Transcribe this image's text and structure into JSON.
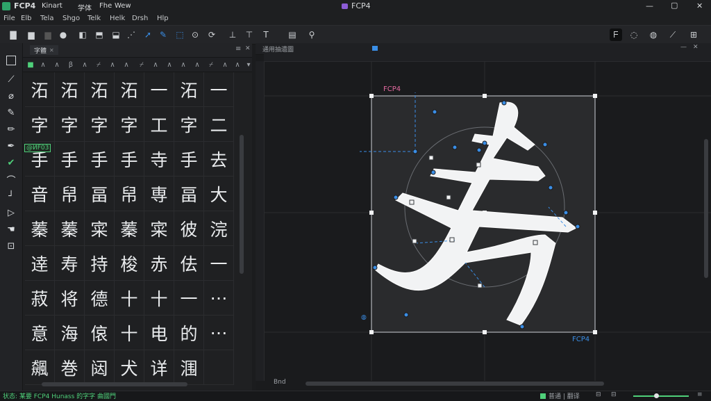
{
  "titlebar": {
    "app_name": "FCP4",
    "menu_left": [
      "Kinart",
      "学体",
      "Fhe",
      "Wew"
    ],
    "window_title": "FCP4",
    "controls": {
      "minimize": "—",
      "maximize": "▢",
      "close": "✕"
    }
  },
  "menubar": {
    "items": [
      "File",
      "Elb",
      "Tela",
      "Shgo",
      "Telk",
      "Helk",
      "Drsh",
      "Hlp"
    ]
  },
  "left_panel": {
    "tab_label": "字體",
    "grid_badge": "@ИF03",
    "glyph_rows": [
      [
        "沰",
        "沰",
        "沰",
        "沰",
        "一",
        "沰",
        "一"
      ],
      [
        "字",
        "字",
        "字",
        "字",
        "工",
        "字",
        "二"
      ],
      [
        "手",
        "手",
        "手",
        "手",
        "寺",
        "手",
        "去"
      ],
      [
        "音",
        "帠",
        "畐",
        "帠",
        "専",
        "畐",
        "大"
      ],
      [
        "蓁",
        "蓁",
        "寀",
        "蓁",
        "寀",
        "彼",
        "浣"
      ],
      [
        "逹",
        "寿",
        "持",
        "梭",
        "赤",
        "佉",
        "一"
      ],
      [
        "菽",
        "将",
        "德",
        "十",
        "十",
        "一",
        "⋯"
      ],
      [
        "意",
        "海",
        "偯",
        "十",
        "电",
        "的",
        "⋯"
      ],
      [
        "飆",
        "巻",
        "闼",
        "犬",
        "详",
        "涠",
        ""
      ]
    ]
  },
  "editor": {
    "tab_label": "通用抽遺圖",
    "glyph_label_top": "FCP4",
    "glyph_label_bottom": "FCP4",
    "glyph_char": "寿",
    "bottom_label": "Bnd"
  },
  "statusbar": {
    "left_text": "状态: 某要 FCP4 Hunass 的字字 曲國門",
    "right_text": "普通 | 翻译",
    "colors": {
      "accent_green": "#4fd07a",
      "accent_blue": "#3a8ee6",
      "accent_pink": "#e46aa0"
    }
  }
}
